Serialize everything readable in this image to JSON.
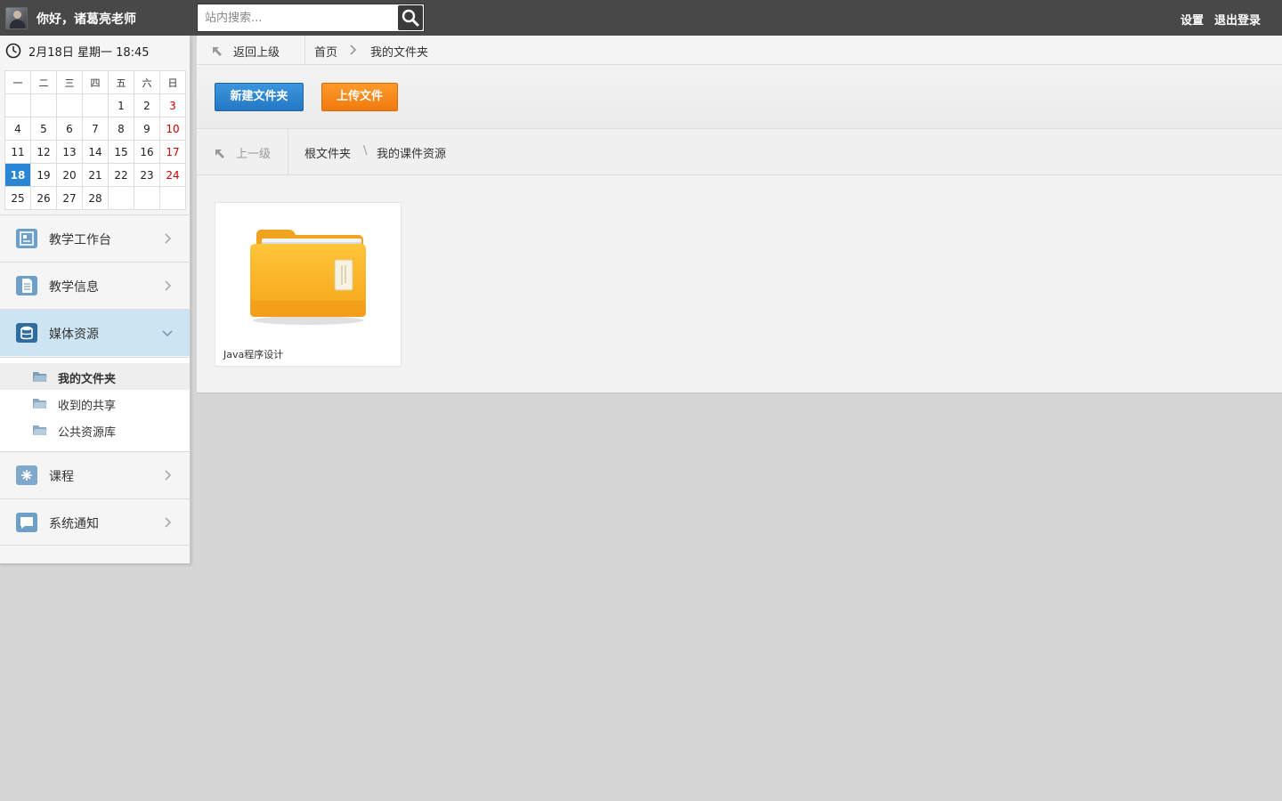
{
  "header": {
    "greeting": "你好，诸葛亮老师",
    "search_placeholder": "站内搜索...",
    "settings": "设置",
    "logout": "退出登录"
  },
  "sidebar": {
    "datetime": "2月18日 星期一 18:45",
    "calendar": {
      "weekdays": [
        "一",
        "二",
        "三",
        "四",
        "五",
        "六",
        "日"
      ],
      "weeks": [
        [
          "",
          "",
          "",
          "",
          "1",
          "2",
          "3"
        ],
        [
          "4",
          "5",
          "6",
          "7",
          "8",
          "9",
          "10"
        ],
        [
          "11",
          "12",
          "13",
          "14",
          "15",
          "16",
          "17"
        ],
        [
          "18",
          "19",
          "20",
          "21",
          "22",
          "23",
          "24"
        ],
        [
          "25",
          "26",
          "27",
          "28",
          "",
          "",
          ""
        ]
      ],
      "today": "18"
    },
    "nav": [
      {
        "label": "教学工作台",
        "icon": "dashboard-icon"
      },
      {
        "label": "教学信息",
        "icon": "document-icon"
      },
      {
        "label": "媒体资源",
        "icon": "database-icon",
        "active": true
      },
      {
        "label": "课程",
        "icon": "course-icon"
      },
      {
        "label": "系统通知",
        "icon": "chat-icon"
      }
    ],
    "media_sub": [
      {
        "label": "我的文件夹",
        "selected": true
      },
      {
        "label": "收到的共享"
      },
      {
        "label": "公共资源库"
      }
    ]
  },
  "main": {
    "breadcrumb": {
      "back": "返回上级",
      "home": "首页",
      "current": "我的文件夹"
    },
    "toolbar": {
      "new_folder": "新建文件夹",
      "upload": "上传文件"
    },
    "folder_nav": {
      "up": "上一级",
      "root": "根文件夹",
      "current": "我的课件资源"
    },
    "files": [
      {
        "name": "Java程序设计",
        "type": "folder"
      }
    ]
  },
  "colors": {
    "topbar": "#484848",
    "primary_button": "#2a86d4",
    "upload_button": "#f08a1c",
    "active_nav": "#cde4f3",
    "calendar_sunday": "#cc0000"
  }
}
